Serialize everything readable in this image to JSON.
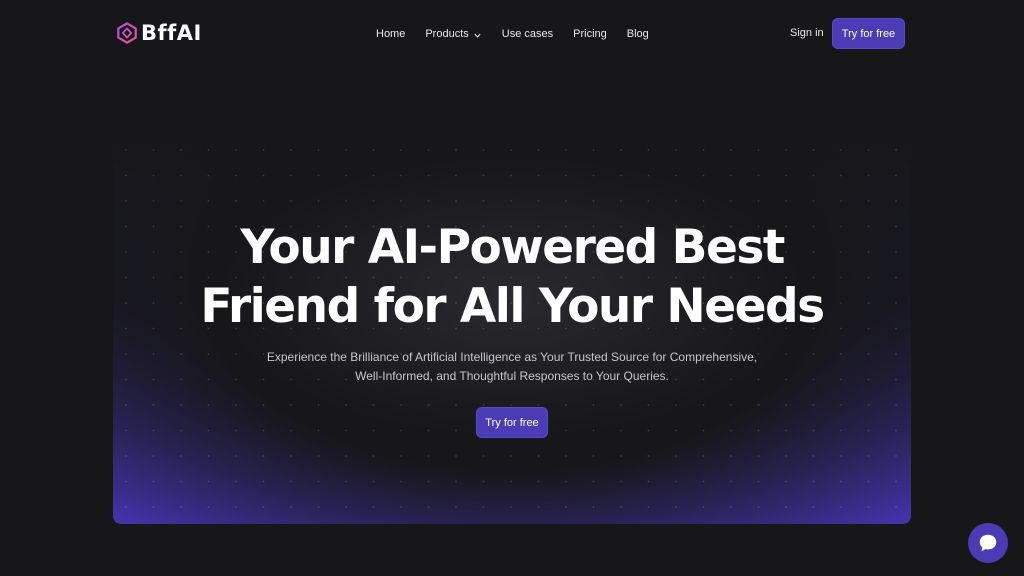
{
  "brand": {
    "name": "BffAI",
    "accent": "#4b3bb4"
  },
  "nav": {
    "items": [
      {
        "label": "Home"
      },
      {
        "label": "Products",
        "has_dropdown": true
      },
      {
        "label": "Use cases"
      },
      {
        "label": "Pricing"
      },
      {
        "label": "Blog"
      }
    ],
    "signin_label": "Sign in",
    "cta_label": "Try for free"
  },
  "hero": {
    "title_line1": "Your AI-Powered Best",
    "title_line2": "Friend for All Your Needs",
    "subtitle": "Experience the Brilliance of Artificial Intelligence as Your Trusted Source for Comprehensive, Well-Informed, and Thoughtful Responses to Your Queries.",
    "cta_label": "Try for free"
  },
  "icons": {
    "logo": "hexagon-logo-icon",
    "dropdown": "chevron-down-icon",
    "chat": "chat-bubble-icon"
  }
}
